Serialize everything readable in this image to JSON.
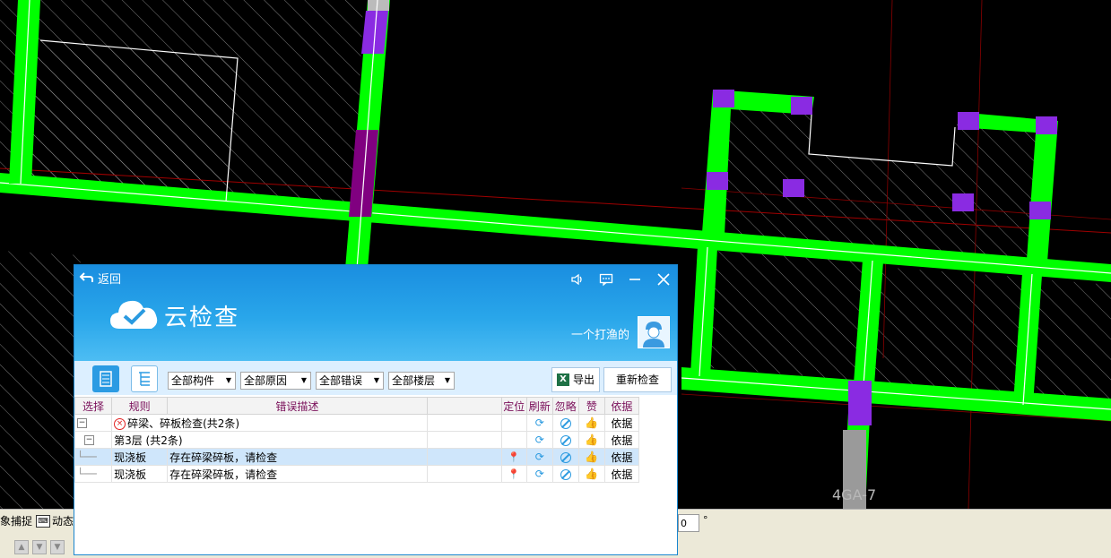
{
  "cad": {
    "grid_label": "4GA-7"
  },
  "status_bar": {
    "items": [
      {
        "icon": "snap-icon",
        "label": "象捕捉"
      },
      {
        "icon": "dynamic-icon",
        "label": "动态"
      }
    ],
    "angle_value": "0",
    "angle_unit": "°"
  },
  "dialog": {
    "back_label": "返回",
    "title": "云检查",
    "user_name": "一个打渔的",
    "header_icons": [
      "speaker-icon",
      "message-icon",
      "minimize-icon",
      "close-icon"
    ],
    "filters": [
      {
        "label": "全部构件"
      },
      {
        "label": "全部原因"
      },
      {
        "label": "全部错误"
      },
      {
        "label": "全部楼层"
      }
    ],
    "export_label": "导出",
    "recheck_label": "重新检查",
    "columns": [
      "选择",
      "规则",
      "错误描述",
      "",
      "定位",
      "刷新",
      "忽略",
      "赞",
      "依据"
    ],
    "rows": {
      "group": {
        "rule": "碎梁、碎板检查(共2条)",
        "basis": "依据"
      },
      "floor": {
        "rule": "第3层 (共2条)",
        "basis": "依据"
      },
      "items": [
        {
          "rule": "现浇板",
          "desc": "存在碎梁碎板，请检查",
          "basis": "依据",
          "selected": true
        },
        {
          "rule": "现浇板",
          "desc": "存在碎梁碎板，请检查",
          "basis": "依据",
          "selected": false
        }
      ]
    }
  }
}
